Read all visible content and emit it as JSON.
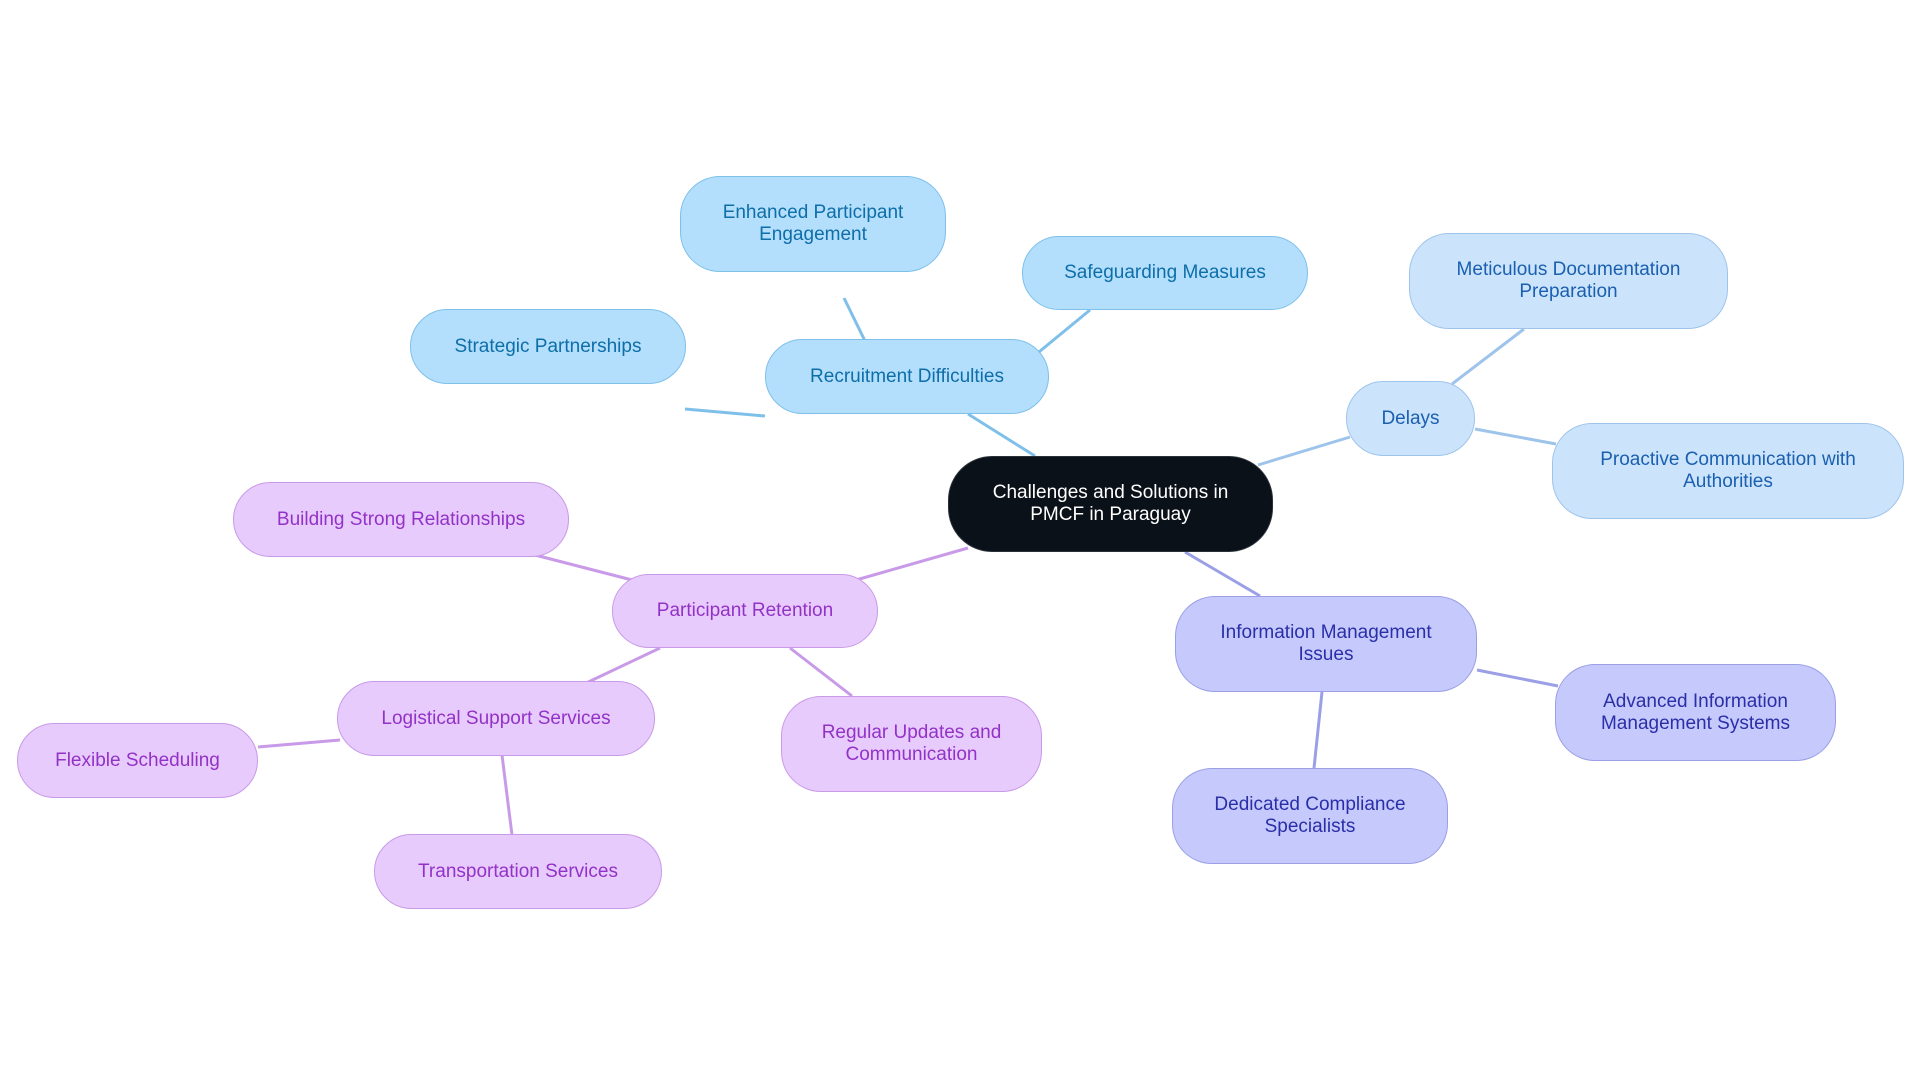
{
  "diagram": {
    "type": "mind-map",
    "root": "Challenges and Solutions in PMCF in Paraguay",
    "branches": [
      {
        "label": "Recruitment Difficulties",
        "color": "#7ec0ea",
        "children": [
          "Enhanced Participant Engagement",
          "Safeguarding Measures",
          "Strategic Partnerships"
        ]
      },
      {
        "label": "Delays",
        "color": "#9ec4ec",
        "children": [
          "Meticulous Documentation Preparation",
          "Proactive Communication with Authorities"
        ]
      },
      {
        "label": "Information Management Issues",
        "color": "#9a9fe6",
        "children": [
          "Advanced Information Management Systems",
          "Dedicated Compliance Specialists"
        ]
      },
      {
        "label": "Participant Retention",
        "color": "#c89ae8",
        "children": [
          "Building Strong Relationships",
          "Logistical Support Services",
          "Regular Updates and Communication"
        ]
      }
    ],
    "sub_children": {
      "Logistical Support Services": [
        "Flexible Scheduling",
        "Transportation Services"
      ]
    }
  },
  "nodes": {
    "root": "Challenges and Solutions in PMCF in Paraguay",
    "recruitment": "Recruitment Difficulties",
    "enhanced": "Enhanced Participant Engagement",
    "safeguarding": "Safeguarding Measures",
    "strategic": "Strategic Partnerships",
    "delays": "Delays",
    "meticulous": "Meticulous Documentation Preparation",
    "proactive": "Proactive Communication with Authorities",
    "info": "Information Management Issues",
    "advanced": "Advanced Information Management Systems",
    "dedicated": "Dedicated Compliance Specialists",
    "retention": "Participant Retention",
    "building": "Building Strong Relationships",
    "logistical": "Logistical Support Services",
    "regular": "Regular Updates and Communication",
    "flexible": "Flexible Scheduling",
    "transportation": "Transportation Services"
  },
  "colors": {
    "root": "#0b1118",
    "recruitment": "#7ec0ea",
    "delays": "#9ec4ec",
    "info": "#9a9fe6",
    "retention": "#c89ae8"
  }
}
